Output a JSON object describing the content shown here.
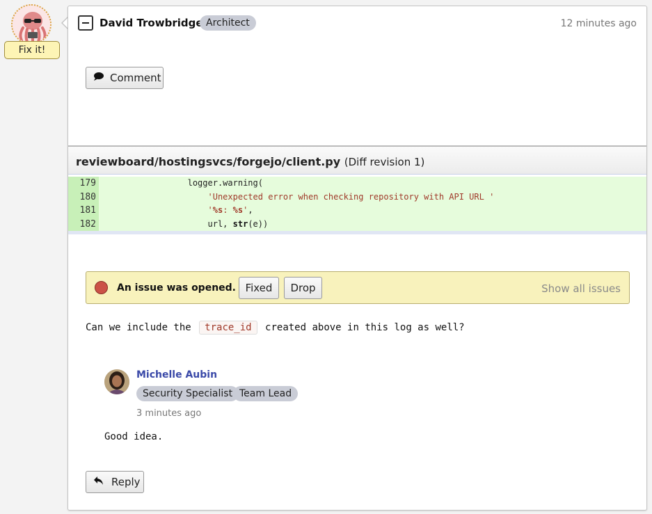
{
  "avatar": {
    "badge": "Fix it!"
  },
  "review": {
    "reviewer_name": "David Trowbridge",
    "reviewer_tag": "Architect",
    "timestamp": "12 minutes ago",
    "comment_button": "Comment",
    "file": {
      "path": "reviewboard/hostingsvcs/forgejo/client.py",
      "revision": "(Diff revision 1)",
      "lines": [
        {
          "num": "179",
          "indent": "                ",
          "parts": [
            {
              "t": "logger.warning(",
              "c": ""
            }
          ]
        },
        {
          "num": "180",
          "indent": "                    ",
          "parts": [
            {
              "t": "'Unexpected error when checking repository with API URL '",
              "c": "str"
            }
          ]
        },
        {
          "num": "181",
          "indent": "                    ",
          "parts": [
            {
              "t": "'",
              "c": "str"
            },
            {
              "t": "%s",
              "c": "fmt"
            },
            {
              "t": ": ",
              "c": "str"
            },
            {
              "t": "%s",
              "c": "fmt"
            },
            {
              "t": "'",
              "c": "str"
            },
            {
              "t": ",",
              "c": ""
            }
          ]
        },
        {
          "num": "182",
          "indent": "                    ",
          "parts": [
            {
              "t": "url, ",
              "c": ""
            },
            {
              "t": "str",
              "c": "kw"
            },
            {
              "t": "(e))",
              "c": ""
            }
          ]
        }
      ]
    },
    "issue": {
      "status_text": "An issue was opened.",
      "fixed_label": "Fixed",
      "drop_label": "Drop",
      "show_all_label": "Show all issues",
      "status_color": "#cb5247"
    },
    "comment": {
      "before": "Can we include the",
      "code": "trace_id",
      "after": "created above in this log as well?"
    },
    "reply": {
      "name": "Michelle Aubin",
      "tags": [
        "Security Specialist",
        "Team Lead"
      ],
      "time": "3 minutes ago",
      "text": "Good idea."
    },
    "reply_button": "Reply"
  }
}
